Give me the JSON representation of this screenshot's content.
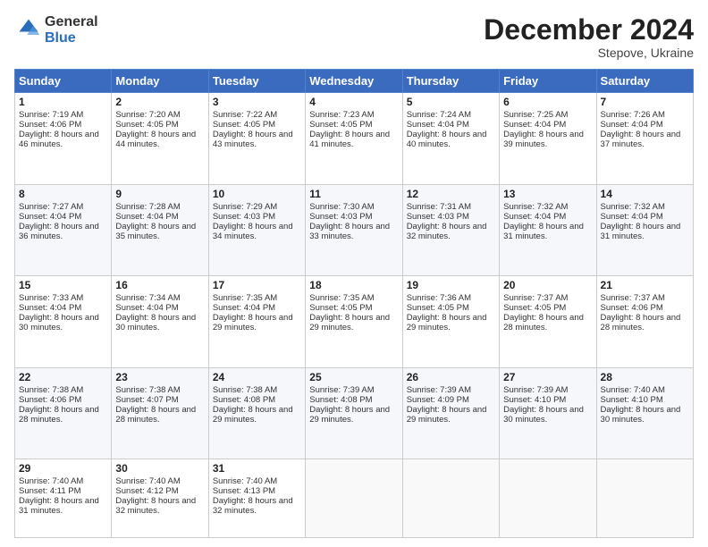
{
  "logo": {
    "line1": "General",
    "line2": "Blue"
  },
  "header": {
    "month": "December 2024",
    "location": "Stepove, Ukraine"
  },
  "weekdays": [
    "Sunday",
    "Monday",
    "Tuesday",
    "Wednesday",
    "Thursday",
    "Friday",
    "Saturday"
  ],
  "weeks": [
    [
      {
        "day": "1",
        "sunrise": "7:19 AM",
        "sunset": "4:06 PM",
        "daylight": "8 hours and 46 minutes."
      },
      {
        "day": "2",
        "sunrise": "7:20 AM",
        "sunset": "4:05 PM",
        "daylight": "8 hours and 44 minutes."
      },
      {
        "day": "3",
        "sunrise": "7:22 AM",
        "sunset": "4:05 PM",
        "daylight": "8 hours and 43 minutes."
      },
      {
        "day": "4",
        "sunrise": "7:23 AM",
        "sunset": "4:05 PM",
        "daylight": "8 hours and 41 minutes."
      },
      {
        "day": "5",
        "sunrise": "7:24 AM",
        "sunset": "4:04 PM",
        "daylight": "8 hours and 40 minutes."
      },
      {
        "day": "6",
        "sunrise": "7:25 AM",
        "sunset": "4:04 PM",
        "daylight": "8 hours and 39 minutes."
      },
      {
        "day": "7",
        "sunrise": "7:26 AM",
        "sunset": "4:04 PM",
        "daylight": "8 hours and 37 minutes."
      }
    ],
    [
      {
        "day": "8",
        "sunrise": "7:27 AM",
        "sunset": "4:04 PM",
        "daylight": "8 hours and 36 minutes."
      },
      {
        "day": "9",
        "sunrise": "7:28 AM",
        "sunset": "4:04 PM",
        "daylight": "8 hours and 35 minutes."
      },
      {
        "day": "10",
        "sunrise": "7:29 AM",
        "sunset": "4:03 PM",
        "daylight": "8 hours and 34 minutes."
      },
      {
        "day": "11",
        "sunrise": "7:30 AM",
        "sunset": "4:03 PM",
        "daylight": "8 hours and 33 minutes."
      },
      {
        "day": "12",
        "sunrise": "7:31 AM",
        "sunset": "4:03 PM",
        "daylight": "8 hours and 32 minutes."
      },
      {
        "day": "13",
        "sunrise": "7:32 AM",
        "sunset": "4:04 PM",
        "daylight": "8 hours and 31 minutes."
      },
      {
        "day": "14",
        "sunrise": "7:32 AM",
        "sunset": "4:04 PM",
        "daylight": "8 hours and 31 minutes."
      }
    ],
    [
      {
        "day": "15",
        "sunrise": "7:33 AM",
        "sunset": "4:04 PM",
        "daylight": "8 hours and 30 minutes."
      },
      {
        "day": "16",
        "sunrise": "7:34 AM",
        "sunset": "4:04 PM",
        "daylight": "8 hours and 30 minutes."
      },
      {
        "day": "17",
        "sunrise": "7:35 AM",
        "sunset": "4:04 PM",
        "daylight": "8 hours and 29 minutes."
      },
      {
        "day": "18",
        "sunrise": "7:35 AM",
        "sunset": "4:05 PM",
        "daylight": "8 hours and 29 minutes."
      },
      {
        "day": "19",
        "sunrise": "7:36 AM",
        "sunset": "4:05 PM",
        "daylight": "8 hours and 29 minutes."
      },
      {
        "day": "20",
        "sunrise": "7:37 AM",
        "sunset": "4:05 PM",
        "daylight": "8 hours and 28 minutes."
      },
      {
        "day": "21",
        "sunrise": "7:37 AM",
        "sunset": "4:06 PM",
        "daylight": "8 hours and 28 minutes."
      }
    ],
    [
      {
        "day": "22",
        "sunrise": "7:38 AM",
        "sunset": "4:06 PM",
        "daylight": "8 hours and 28 minutes."
      },
      {
        "day": "23",
        "sunrise": "7:38 AM",
        "sunset": "4:07 PM",
        "daylight": "8 hours and 28 minutes."
      },
      {
        "day": "24",
        "sunrise": "7:38 AM",
        "sunset": "4:08 PM",
        "daylight": "8 hours and 29 minutes."
      },
      {
        "day": "25",
        "sunrise": "7:39 AM",
        "sunset": "4:08 PM",
        "daylight": "8 hours and 29 minutes."
      },
      {
        "day": "26",
        "sunrise": "7:39 AM",
        "sunset": "4:09 PM",
        "daylight": "8 hours and 29 minutes."
      },
      {
        "day": "27",
        "sunrise": "7:39 AM",
        "sunset": "4:10 PM",
        "daylight": "8 hours and 30 minutes."
      },
      {
        "day": "28",
        "sunrise": "7:40 AM",
        "sunset": "4:10 PM",
        "daylight": "8 hours and 30 minutes."
      }
    ],
    [
      {
        "day": "29",
        "sunrise": "7:40 AM",
        "sunset": "4:11 PM",
        "daylight": "8 hours and 31 minutes."
      },
      {
        "day": "30",
        "sunrise": "7:40 AM",
        "sunset": "4:12 PM",
        "daylight": "8 hours and 32 minutes."
      },
      {
        "day": "31",
        "sunrise": "7:40 AM",
        "sunset": "4:13 PM",
        "daylight": "8 hours and 32 minutes."
      },
      null,
      null,
      null,
      null
    ]
  ]
}
